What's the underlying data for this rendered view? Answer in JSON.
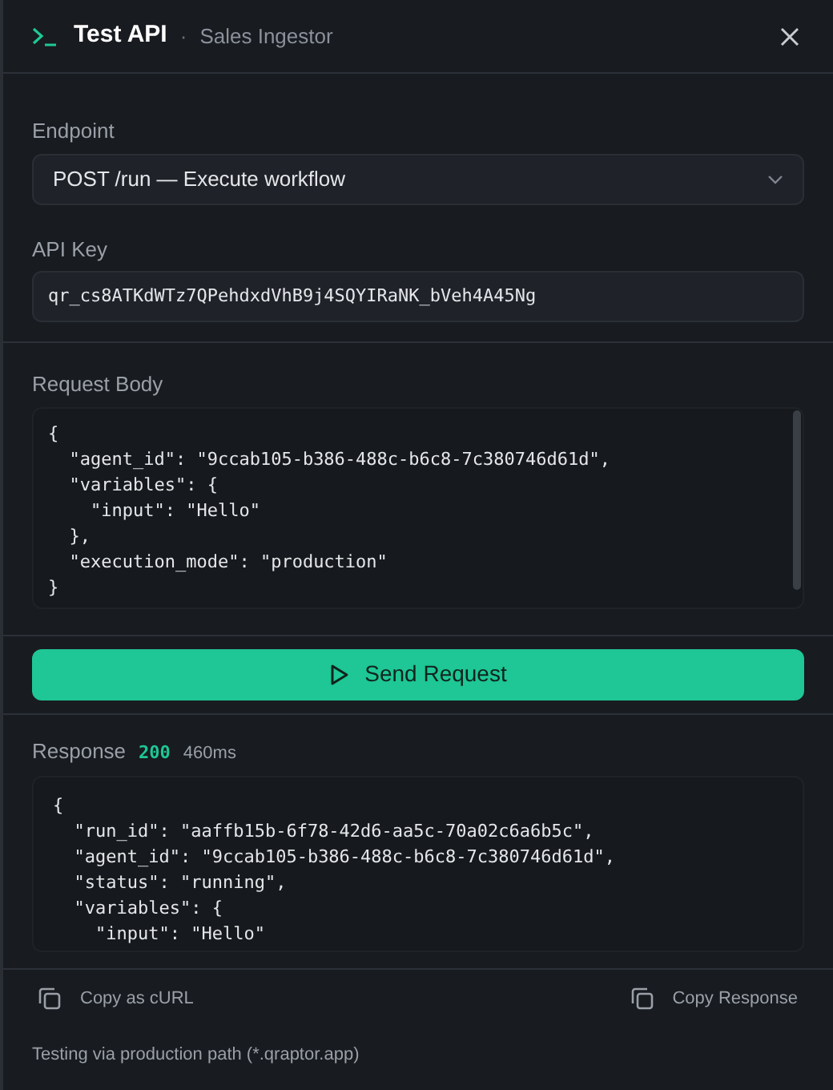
{
  "header": {
    "title": "Test API",
    "separator": "·",
    "subtitle": "Sales Ingestor"
  },
  "endpoint": {
    "label": "Endpoint",
    "value": "POST /run — Execute workflow"
  },
  "api_key": {
    "label": "API Key",
    "value": "qr_cs8ATKdWTz7QPehdxdVhB9j4SQYIRaNK_bVeh4A45Ng"
  },
  "request_body": {
    "label": "Request Body",
    "lines": [
      "{",
      "  \"agent_id\": \"9ccab105-b386-488c-b6c8-7c380746d61d\",",
      "  \"variables\": {",
      "    \"input\": \"Hello\"",
      "  },",
      "  \"execution_mode\": \"production\"",
      "}"
    ]
  },
  "send_button": {
    "label": "Send Request"
  },
  "response": {
    "label": "Response",
    "status": "200",
    "time": "460ms",
    "lines": [
      "{",
      "  \"run_id\": \"aaffb15b-6f78-42d6-aa5c-70a02c6a6b5c\",",
      "  \"agent_id\": \"9ccab105-b386-488c-b6c8-7c380746d61d\",",
      "  \"status\": \"running\",",
      "  \"variables\": {",
      "    \"input\": \"Hello\""
    ]
  },
  "actions": [
    {
      "label": "Copy as cURL"
    },
    {
      "label": "Copy Response"
    }
  ],
  "footer": "Testing via production path (*.qraptor.app)"
}
